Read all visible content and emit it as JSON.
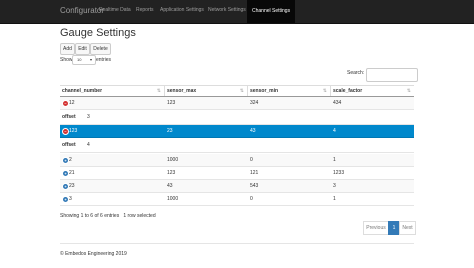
{
  "navbar": {
    "brand": "Configurator",
    "items": [
      {
        "label": "Realtime Data"
      },
      {
        "label": "Reports"
      },
      {
        "label": "Application Settings"
      },
      {
        "label": "Network Settings"
      },
      {
        "label": "Channel Settings",
        "active": true
      }
    ]
  },
  "page": {
    "title": "Gauge Settings"
  },
  "toolbar": {
    "add": "Add",
    "edit": "Edit",
    "delete": "Delete"
  },
  "length": {
    "show": "Show",
    "value": "10",
    "entries": "entries"
  },
  "search": {
    "label": "Search:",
    "value": ""
  },
  "table": {
    "headers": [
      "channel_number",
      "sensor_max",
      "sensor_min",
      "scale_factor"
    ],
    "rows": [
      {
        "channel_number": "12",
        "sensor_max": "123",
        "sensor_min": "324",
        "scale_factor": "434",
        "expanded": true,
        "detail_label": "offset",
        "detail_value": "3"
      },
      {
        "channel_number": "123",
        "sensor_max": "23",
        "sensor_min": "43",
        "scale_factor": "4",
        "expanded": true,
        "selected": true,
        "detail_label": "offset",
        "detail_value": "4"
      },
      {
        "channel_number": "2",
        "sensor_max": "1000",
        "sensor_min": "0",
        "scale_factor": "1"
      },
      {
        "channel_number": "21",
        "sensor_max": "123",
        "sensor_min": "121",
        "scale_factor": "1233"
      },
      {
        "channel_number": "23",
        "sensor_max": "43",
        "sensor_min": "543",
        "scale_factor": "3"
      },
      {
        "channel_number": "3",
        "sensor_max": "1000",
        "sensor_min": "0",
        "scale_factor": "1"
      }
    ]
  },
  "info": "Showing 1 to 6 of 6 entries   1 row selected",
  "pagination": {
    "previous": "Previous",
    "page": "1",
    "next": "Next"
  },
  "footer": "© Embedos Engineering 2019"
}
